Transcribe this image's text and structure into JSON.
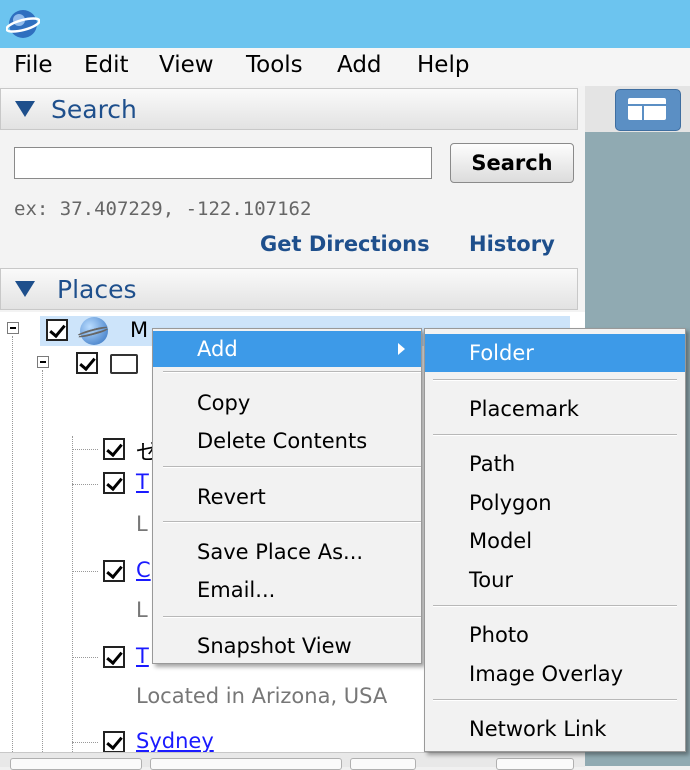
{
  "menubar": [
    "File",
    "Edit",
    "View",
    "Tools",
    "Add",
    "Help"
  ],
  "search": {
    "header": "Search",
    "input_value": "",
    "button": "Search",
    "hint": "ex: 37.407229, -122.107162",
    "get_directions": "Get Directions",
    "history": "History"
  },
  "places": {
    "header": "Places",
    "root_label_partial": "M",
    "items": [
      {
        "label": "ゼ"
      },
      {
        "label": "T",
        "sub": "L"
      },
      {
        "label": "C",
        "sub": "L"
      },
      {
        "label": "T",
        "sub": "Located in Arizona, USA"
      },
      {
        "label": "Sydney"
      }
    ]
  },
  "context_menu": {
    "items": [
      "Add",
      "Copy",
      "Delete Contents",
      "Revert",
      "Save Place As...",
      "Email...",
      "Snapshot View"
    ]
  },
  "add_submenu": {
    "items": [
      "Folder",
      "Placemark",
      "Path",
      "Polygon",
      "Model",
      "Tour",
      "Photo",
      "Image Overlay",
      "Network Link"
    ]
  },
  "colors": {
    "titlebar": "#6cc4ef",
    "accent_blue": "#1e4f8c",
    "menu_highlight": "#3d9ae8",
    "link": "#1a1aff"
  }
}
